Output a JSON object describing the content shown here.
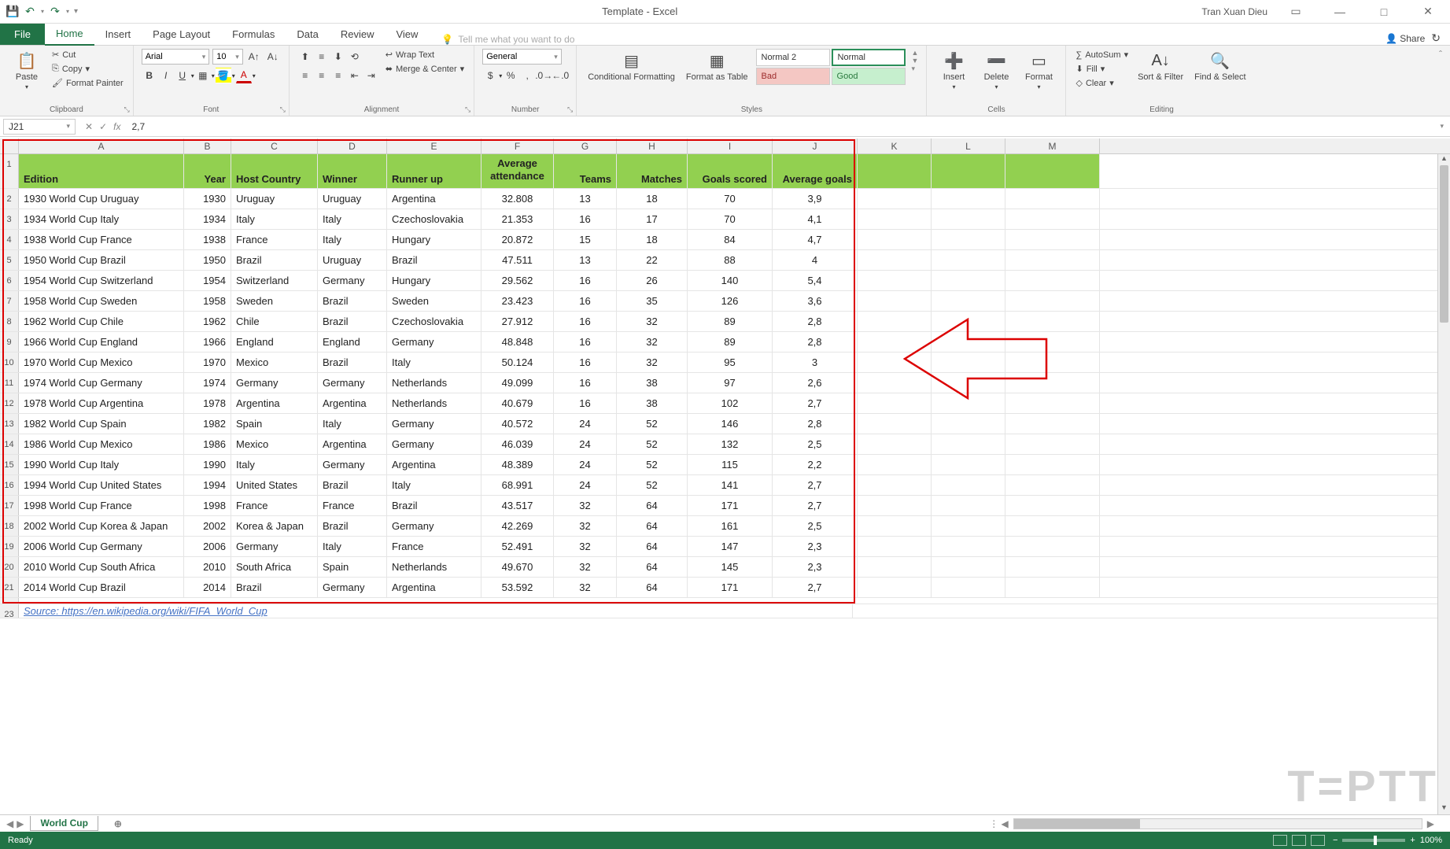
{
  "title": "Template - Excel",
  "user": "Tran Xuan Dieu",
  "qat": {
    "save": "💾",
    "undo": "↶",
    "redo": "↷"
  },
  "tabs": {
    "file": "File",
    "home": "Home",
    "insert": "Insert",
    "page_layout": "Page Layout",
    "formulas": "Formulas",
    "data": "Data",
    "review": "Review",
    "view": "View"
  },
  "tell_me": "Tell me what you want to do",
  "share": "Share",
  "ribbon": {
    "clipboard": {
      "paste": "Paste",
      "cut": "Cut",
      "copy": "Copy",
      "format_painter": "Format Painter",
      "label": "Clipboard"
    },
    "font": {
      "name": "Arial",
      "size": "10",
      "label": "Font"
    },
    "alignment": {
      "wrap": "Wrap Text",
      "merge": "Merge & Center",
      "label": "Alignment"
    },
    "number": {
      "format": "General",
      "label": "Number"
    },
    "styles": {
      "cond": "Conditional Formatting",
      "fat": "Format as Table",
      "normal2": "Normal 2",
      "normal": "Normal",
      "bad": "Bad",
      "good": "Good",
      "label": "Styles"
    },
    "cells": {
      "insert": "Insert",
      "delete": "Delete",
      "format": "Format",
      "label": "Cells"
    },
    "editing": {
      "autosum": "AutoSum",
      "fill": "Fill",
      "clear": "Clear",
      "sort": "Sort & Filter",
      "find": "Find & Select",
      "label": "Editing"
    }
  },
  "name_box": "J21",
  "formula": "2,7",
  "columns": [
    "A",
    "B",
    "C",
    "D",
    "E",
    "F",
    "G",
    "H",
    "I",
    "J",
    "K",
    "L",
    "M"
  ],
  "headers": [
    "Edition",
    "Year",
    "Host Country",
    "Winner",
    "Runner up",
    "Average attendance",
    "Teams",
    "Matches",
    "Goals scored",
    "Average goals"
  ],
  "rows": [
    {
      "n": 2,
      "a": "1930 World Cup Uruguay",
      "b": "1930",
      "c": "Uruguay",
      "d": "Uruguay",
      "e": "Argentina",
      "f": "32.808",
      "g": "13",
      "h": "18",
      "i": "70",
      "j": "3,9"
    },
    {
      "n": 3,
      "a": "1934 World Cup Italy",
      "b": "1934",
      "c": "Italy",
      "d": "Italy",
      "e": "Czechoslovakia",
      "f": "21.353",
      "g": "16",
      "h": "17",
      "i": "70",
      "j": "4,1"
    },
    {
      "n": 4,
      "a": "1938 World Cup France",
      "b": "1938",
      "c": "France",
      "d": "Italy",
      "e": "Hungary",
      "f": "20.872",
      "g": "15",
      "h": "18",
      "i": "84",
      "j": "4,7"
    },
    {
      "n": 5,
      "a": "1950 World Cup Brazil",
      "b": "1950",
      "c": "Brazil",
      "d": "Uruguay",
      "e": "Brazil",
      "f": "47.511",
      "g": "13",
      "h": "22",
      "i": "88",
      "j": "4"
    },
    {
      "n": 6,
      "a": "1954 World Cup Switzerland",
      "b": "1954",
      "c": "Switzerland",
      "d": "Germany",
      "e": "Hungary",
      "f": "29.562",
      "g": "16",
      "h": "26",
      "i": "140",
      "j": "5,4"
    },
    {
      "n": 7,
      "a": "1958 World Cup Sweden",
      "b": "1958",
      "c": "Sweden",
      "d": "Brazil",
      "e": "Sweden",
      "f": "23.423",
      "g": "16",
      "h": "35",
      "i": "126",
      "j": "3,6"
    },
    {
      "n": 8,
      "a": "1962 World Cup Chile",
      "b": "1962",
      "c": "Chile",
      "d": "Brazil",
      "e": "Czechoslovakia",
      "f": "27.912",
      "g": "16",
      "h": "32",
      "i": "89",
      "j": "2,8"
    },
    {
      "n": 9,
      "a": "1966 World Cup England",
      "b": "1966",
      "c": "England",
      "d": "England",
      "e": "Germany",
      "f": "48.848",
      "g": "16",
      "h": "32",
      "i": "89",
      "j": "2,8"
    },
    {
      "n": 10,
      "a": "1970 World Cup Mexico",
      "b": "1970",
      "c": "Mexico",
      "d": "Brazil",
      "e": "Italy",
      "f": "50.124",
      "g": "16",
      "h": "32",
      "i": "95",
      "j": "3"
    },
    {
      "n": 11,
      "a": "1974 World Cup Germany",
      "b": "1974",
      "c": "Germany",
      "d": "Germany",
      "e": "Netherlands",
      "f": "49.099",
      "g": "16",
      "h": "38",
      "i": "97",
      "j": "2,6"
    },
    {
      "n": 12,
      "a": "1978 World Cup Argentina",
      "b": "1978",
      "c": "Argentina",
      "d": "Argentina",
      "e": "Netherlands",
      "f": "40.679",
      "g": "16",
      "h": "38",
      "i": "102",
      "j": "2,7"
    },
    {
      "n": 13,
      "a": "1982 World Cup Spain",
      "b": "1982",
      "c": "Spain",
      "d": "Italy",
      "e": "Germany",
      "f": "40.572",
      "g": "24",
      "h": "52",
      "i": "146",
      "j": "2,8"
    },
    {
      "n": 14,
      "a": "1986 World Cup Mexico",
      "b": "1986",
      "c": "Mexico",
      "d": "Argentina",
      "e": "Germany",
      "f": "46.039",
      "g": "24",
      "h": "52",
      "i": "132",
      "j": "2,5"
    },
    {
      "n": 15,
      "a": "1990 World Cup Italy",
      "b": "1990",
      "c": "Italy",
      "d": "Germany",
      "e": "Argentina",
      "f": "48.389",
      "g": "24",
      "h": "52",
      "i": "115",
      "j": "2,2"
    },
    {
      "n": 16,
      "a": "1994 World Cup United States",
      "b": "1994",
      "c": "United States",
      "d": "Brazil",
      "e": "Italy",
      "f": "68.991",
      "g": "24",
      "h": "52",
      "i": "141",
      "j": "2,7"
    },
    {
      "n": 17,
      "a": "1998 World Cup France",
      "b": "1998",
      "c": "France",
      "d": "France",
      "e": "Brazil",
      "f": "43.517",
      "g": "32",
      "h": "64",
      "i": "171",
      "j": "2,7"
    },
    {
      "n": 18,
      "a": "2002 World Cup Korea & Japan",
      "b": "2002",
      "c": "Korea & Japan",
      "d": "Brazil",
      "e": "Germany",
      "f": "42.269",
      "g": "32",
      "h": "64",
      "i": "161",
      "j": "2,5"
    },
    {
      "n": 19,
      "a": "2006 World Cup Germany",
      "b": "2006",
      "c": "Germany",
      "d": "Italy",
      "e": "France",
      "f": "52.491",
      "g": "32",
      "h": "64",
      "i": "147",
      "j": "2,3"
    },
    {
      "n": 20,
      "a": "2010 World Cup South Africa",
      "b": "2010",
      "c": "South Africa",
      "d": "Spain",
      "e": "Netherlands",
      "f": "49.670",
      "g": "32",
      "h": "64",
      "i": "145",
      "j": "2,3"
    },
    {
      "n": 21,
      "a": "2014 World Cup Brazil",
      "b": "2014",
      "c": "Brazil",
      "d": "Germany",
      "e": "Argentina",
      "f": "53.592",
      "g": "32",
      "h": "64",
      "i": "171",
      "j": "2,7"
    }
  ],
  "source_row_n": "23",
  "source_text": "Source: https://en.wikipedia.org/wiki/FIFA_World_Cup",
  "sheet_tab": "World Cup",
  "status": "Ready",
  "zoom": "100%",
  "watermark": "T=PTT"
}
